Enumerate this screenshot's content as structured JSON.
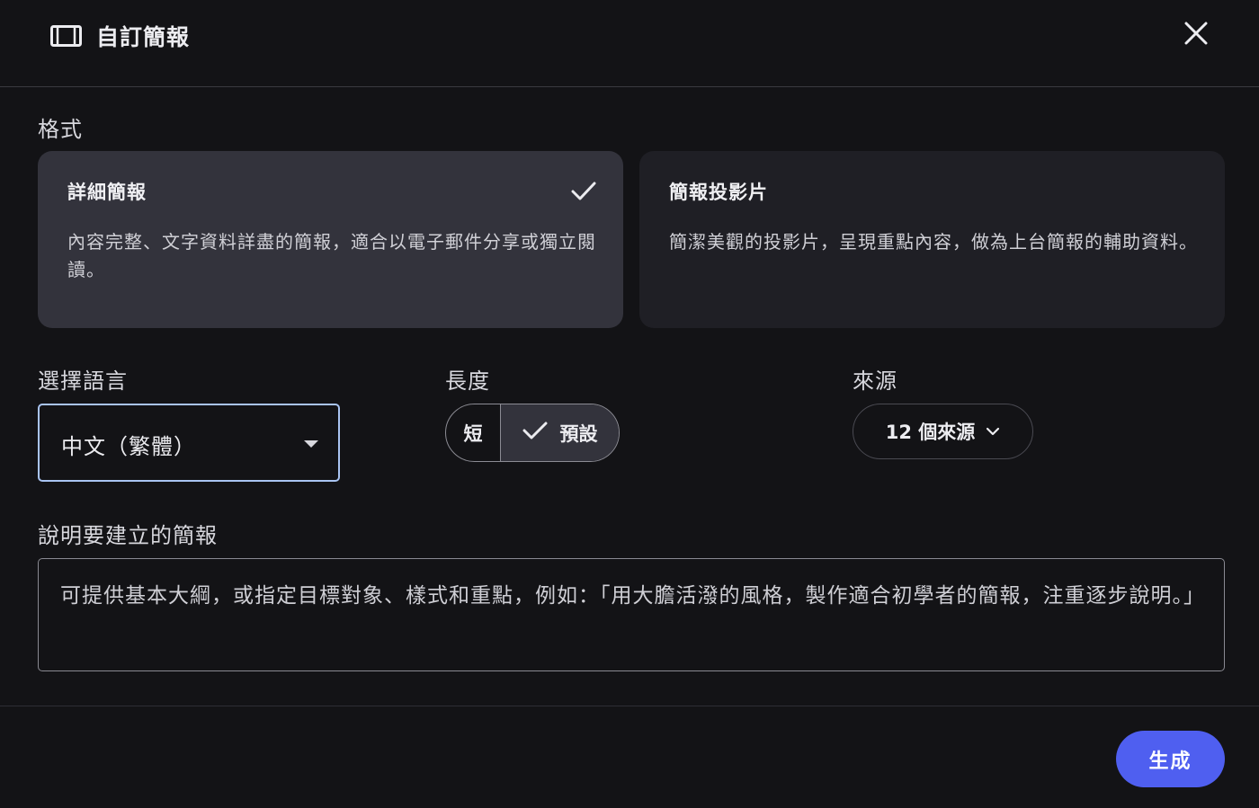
{
  "header": {
    "title": "自訂簡報",
    "icon": "slides-icon",
    "close_icon": "close-icon"
  },
  "format": {
    "label": "格式",
    "options": [
      {
        "title": "詳細簡報",
        "description": "內容完整、文字資料詳盡的簡報，適合以電子郵件分享或獨立閱讀。",
        "selected": true
      },
      {
        "title": "簡報投影片",
        "description": "簡潔美觀的投影片，呈現重點內容，做為上台簡報的輔助資料。",
        "selected": false
      }
    ]
  },
  "language": {
    "label": "選擇語言",
    "value": "中文（繁體）"
  },
  "length": {
    "label": "長度",
    "options": [
      "短",
      "預設"
    ],
    "selected": "預設"
  },
  "sources": {
    "label": "來源",
    "button_label": "12 個來源"
  },
  "prompt": {
    "label": "說明要建立的簡報",
    "placeholder": "可提供基本大綱，或指定目標對象、樣式和重點，例如：「用大膽活潑的風格，製作適合初學者的簡報，注重逐步說明。」"
  },
  "footer": {
    "generate_label": "生成"
  },
  "colors": {
    "background": "#131316",
    "selected_card": "#33333c",
    "card": "#1f1f25",
    "accent": "#4f5ff0",
    "focus_border": "#a9c4f2"
  }
}
